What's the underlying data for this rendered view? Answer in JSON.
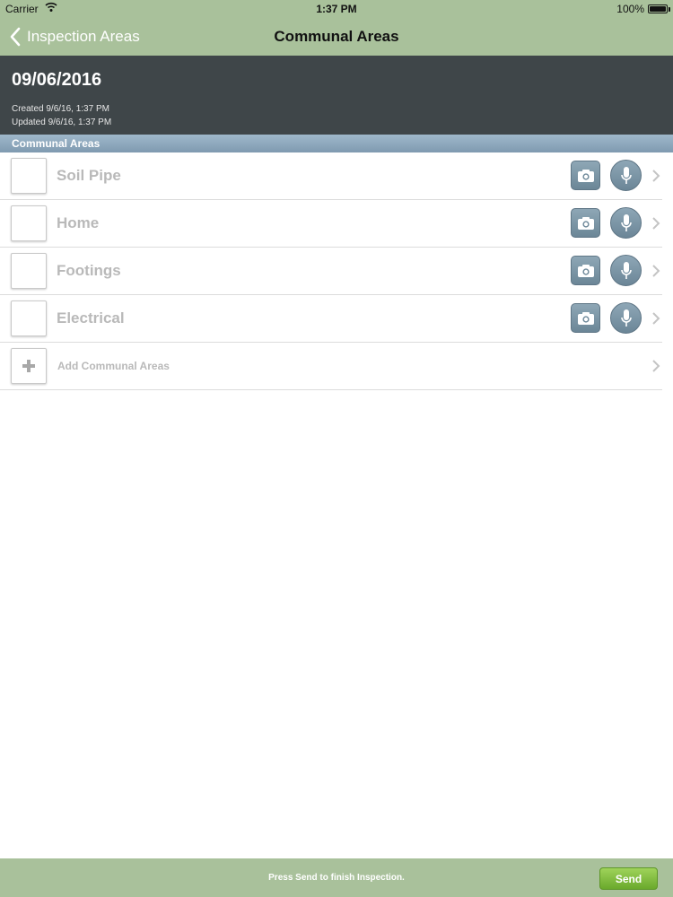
{
  "status_bar": {
    "carrier": "Carrier",
    "time": "1:37 PM",
    "battery": "100%"
  },
  "nav": {
    "back_label": "Inspection Areas",
    "title": "Communal Areas"
  },
  "header": {
    "date": "09/06/2016",
    "created": "Created 9/6/16, 1:37 PM",
    "updated": "Updated 9/6/16, 1:37 PM"
  },
  "section": {
    "title": "Communal Areas"
  },
  "items": [
    {
      "label": "Soil Pipe"
    },
    {
      "label": "Home"
    },
    {
      "label": "Footings"
    },
    {
      "label": "Electrical"
    }
  ],
  "add_item": {
    "label": "Add Communal Areas"
  },
  "footer": {
    "message": "Press Send to finish Inspection.",
    "send_label": "Send"
  },
  "icons": [
    "wifi-icon",
    "battery-icon",
    "back-chevron-icon",
    "camera-icon",
    "microphone-icon",
    "chevron-right-icon",
    "plus-icon"
  ],
  "colors": {
    "nav_bg": "#a9c19b",
    "header_bg": "#3f4649",
    "section_bg": "#8ea7bc",
    "action_btn": "#7a93a3",
    "send_btn": "#7dbb3c"
  }
}
